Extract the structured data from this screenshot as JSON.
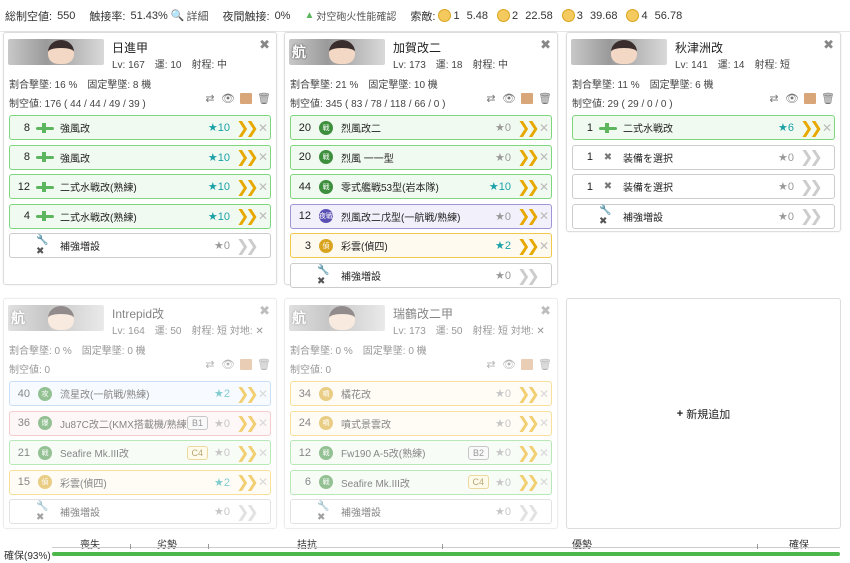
{
  "topbar": {
    "air_label": "総制空値:",
    "air_value": "550",
    "shootdown_label": "触接率:",
    "shootdown_value": "51.43%",
    "detail_label": "詳細",
    "night_label": "夜間触接:",
    "night_value": "0%",
    "aa_check_label": "対空砲火性能確認",
    "enemy_label": "索敵:",
    "sup1": "5.48",
    "sup2": "22.58",
    "sup3": "39.68",
    "sup4": "56.78",
    "sup1_n": "1",
    "sup2_n": "2",
    "sup3_n": "3",
    "sup4_n": "4"
  },
  "ships": [
    {
      "name": "日進甲",
      "kanji": "",
      "stats": "Lv: 167　運: 10　射程: 中",
      "line1": "割合撃墜: 16 %　固定撃墜: 8 機",
      "line2": "制空値: 176 ( 44 / 44 / 49 / 39 )",
      "slots": [
        {
          "count": "8",
          "name": "強風改",
          "stars": "★10"
        },
        {
          "count": "8",
          "name": "強風改",
          "stars": "★10"
        },
        {
          "count": "12",
          "name": "二式水戦改(熟練)",
          "stars": "★10"
        },
        {
          "count": "4",
          "name": "二式水戦改(熟練)",
          "stars": "★10"
        },
        {
          "count": "",
          "name": "補強増設",
          "stars": "★0"
        }
      ]
    },
    {
      "name": "加賀改二",
      "kanji": "航",
      "stats": "Lv: 173　運: 18　射程: 中",
      "line1": "割合撃墜: 21 %　固定撃墜: 10 機",
      "line2": "制空値: 345 ( 83 / 78 / 118 / 66 / 0 )",
      "slots": [
        {
          "count": "20",
          "name": "烈風改二",
          "stars": "★0",
          "icon_text": "戦"
        },
        {
          "count": "20",
          "name": "烈風 一一型",
          "stars": "★0",
          "icon_text": "戦"
        },
        {
          "count": "44",
          "name": "零式艦戦53型(岩本隊)",
          "stars": "★10",
          "icon_text": "戦"
        },
        {
          "count": "12",
          "name": "烈風改二戊型(一航戦/熟練)",
          "stars": "★0",
          "icon_text": "夜戦"
        },
        {
          "count": "3",
          "name": "彩雲(偵四)",
          "stars": "★2",
          "icon_text": "偵"
        },
        {
          "count": "",
          "name": "補強増設",
          "stars": "★0"
        }
      ]
    },
    {
      "name": "秋津洲改",
      "kanji": "",
      "stats": "Lv: 141　運: 14　射程: 短",
      "line1": "割合撃墜: 11 %　固定撃墜: 6 機",
      "line2": "制空値: 29 ( 29 / 0 / 0 )",
      "slots": [
        {
          "count": "1",
          "name": "二式水戦改",
          "stars": "★6"
        },
        {
          "count": "1",
          "name": "装備を選択",
          "stars": "★0"
        },
        {
          "count": "1",
          "name": "装備を選択",
          "stars": "★0"
        },
        {
          "count": "",
          "name": "補強増設",
          "stars": "★0"
        }
      ]
    },
    {
      "name": "Intrepid改",
      "kanji": "航",
      "stats": "Lv: 164　運: 50　射程: 短",
      "stats_extra": "対地:",
      "line1": "割合撃墜: 0 %　固定撃墜: 0 機",
      "line2": "制空値: 0",
      "slots": [
        {
          "count": "40",
          "name": "流星改(一航戦/熟練)",
          "stars": "★2",
          "icon_text": "攻"
        },
        {
          "count": "36",
          "name": "Ju87C改二(KMX搭載機/熟練)",
          "stars": "★0",
          "tag": "B1",
          "icon_text": "爆"
        },
        {
          "count": "21",
          "name": "Seafire Mk.III改",
          "stars": "★0",
          "tag": "C4",
          "icon_text": "戦"
        },
        {
          "count": "15",
          "name": "彩雲(偵四)",
          "stars": "★2",
          "icon_text": "偵"
        },
        {
          "count": "",
          "name": "補強増設",
          "stars": "★0"
        }
      ]
    },
    {
      "name": "瑞鶴改二甲",
      "kanji": "航",
      "stats": "Lv: 173　運: 50　射程: 短",
      "stats_extra": "対地:",
      "line1": "割合撃墜: 0 %　固定撃墜: 0 機",
      "line2": "制空値: 0",
      "slots": [
        {
          "count": "34",
          "name": "橘花改",
          "stars": "★0",
          "icon_text": "噴"
        },
        {
          "count": "24",
          "name": "噴式景雲改",
          "stars": "★0",
          "icon_text": "噴"
        },
        {
          "count": "12",
          "name": "Fw190 A-5改(熟練)",
          "stars": "★0",
          "tag": "B2",
          "icon_text": "戦"
        },
        {
          "count": "6",
          "name": "Seafire Mk.III改",
          "stars": "★0",
          "tag": "C4",
          "icon_text": "戦"
        },
        {
          "count": "",
          "name": "補強増設",
          "stars": "★0"
        }
      ]
    }
  ],
  "add_new_label": "新規追加",
  "air_bar": {
    "labels": [
      "喪失",
      "劣勢",
      "拮抗",
      "優勢",
      "確保"
    ],
    "status": "確保(93%)",
    "fill_percent": 100
  },
  "colors": {
    "accent_star": "#1aa1a7",
    "chevron": "#e7a800",
    "fighter_green": "#5db55d"
  }
}
